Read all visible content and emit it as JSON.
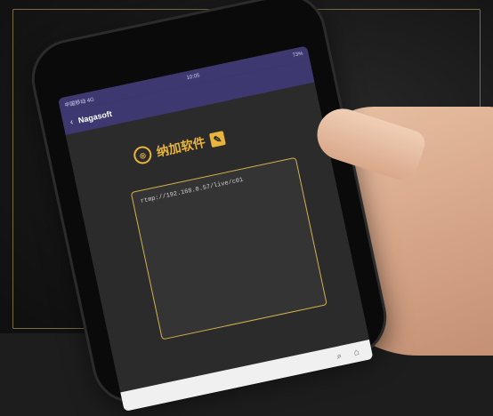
{
  "status": {
    "carrier": "中国移动 4G",
    "time": "10:05",
    "battery": "73%"
  },
  "app": {
    "title": "Nagasoft",
    "back_symbol": "‹"
  },
  "brand": {
    "name": "纳加软件"
  },
  "stream": {
    "url": "rtmp://192.168.0.57/live/c01"
  },
  "colors": {
    "accent": "#e9b43c",
    "header": "#3d3870"
  },
  "icons": {
    "logo": "brand-logo-icon",
    "edit": "edit-icon",
    "search": "search-icon",
    "home": "home-icon"
  }
}
